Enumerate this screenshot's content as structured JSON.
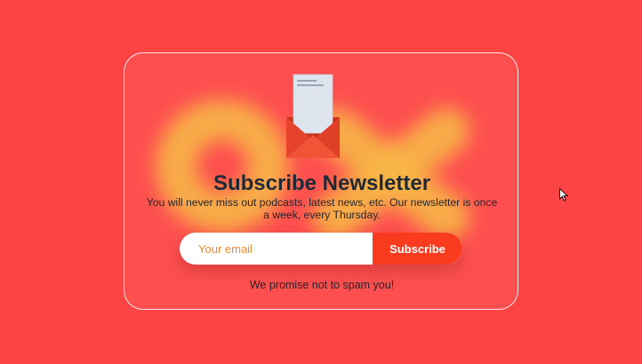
{
  "newsletter": {
    "title": "Subscribe Newsletter",
    "description": "You will never miss out podcasts, latest news, etc. Our newsletter is once a week, every Thursday.",
    "email_placeholder": "Your email",
    "subscribe_label": "Subscribe",
    "promise": "We promise not to spam you!"
  },
  "icons": {
    "envelope": "envelope-letter-icon",
    "cursor": "mouse-pointer-icon"
  },
  "colors": {
    "background": "#fd4444",
    "accent": "#fb3b1e",
    "blob": "#f6c93a",
    "title": "#1f2a36",
    "placeholder": "#f28a2e"
  }
}
